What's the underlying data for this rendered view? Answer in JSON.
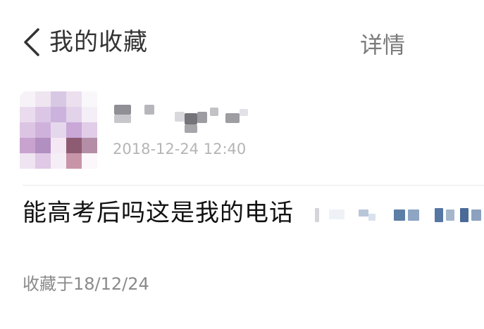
{
  "header": {
    "back_icon": "chevron-left-icon",
    "title": "我的收藏",
    "details_label": "详情"
  },
  "post": {
    "timestamp": "2018-12-24 12:40",
    "message": "能高考后吗这是我的电话"
  },
  "footer": {
    "saved_at": "收藏于18/12/24"
  },
  "colors": {
    "title": "#333333",
    "details": "#7a7a7a",
    "timestamp": "#b5b5b5",
    "message": "#111111",
    "saved_at": "#8a8a8a",
    "divider": "#e9e9ee"
  }
}
